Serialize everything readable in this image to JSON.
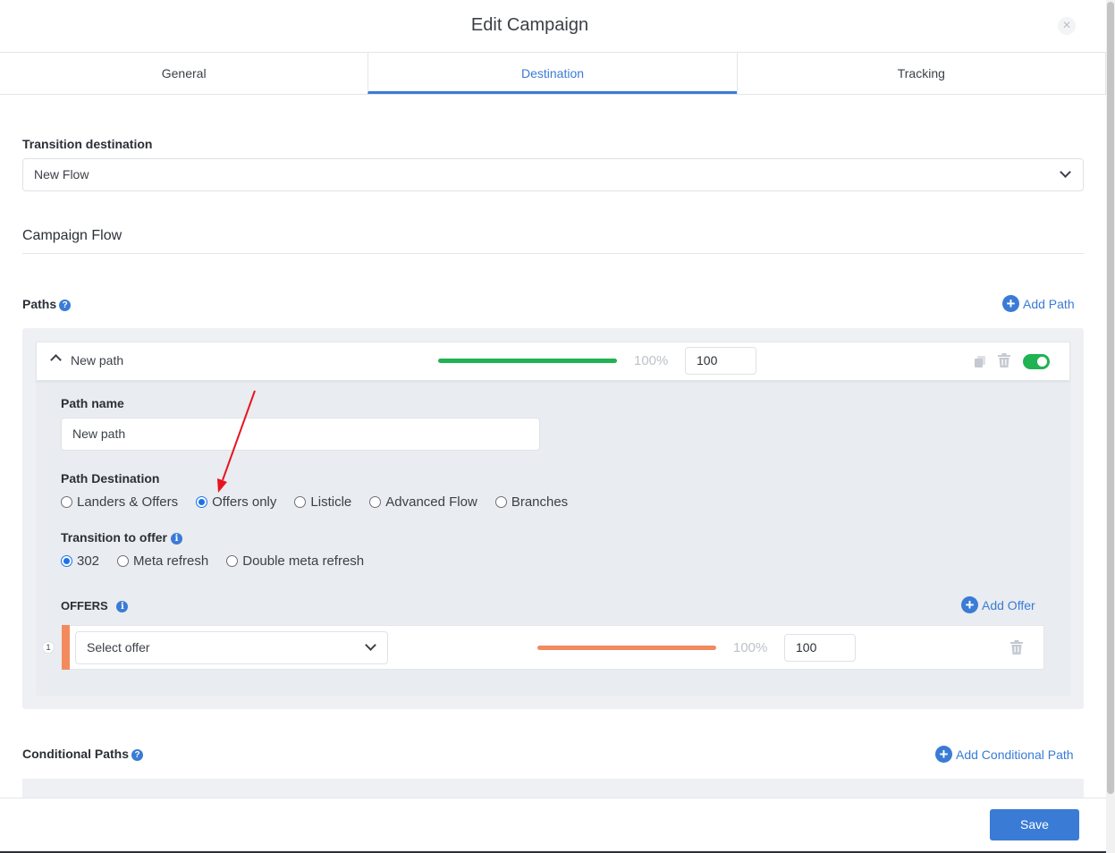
{
  "modal": {
    "title": "Edit Campaign",
    "close_glyph": "×"
  },
  "tabs": [
    {
      "label": "General"
    },
    {
      "label": "Destination"
    },
    {
      "label": "Tracking"
    }
  ],
  "transition_destination": {
    "label": "Transition destination",
    "value": "New Flow"
  },
  "campaign_flow": {
    "title": "Campaign Flow"
  },
  "paths": {
    "label": "Paths",
    "add_label": "Add Path",
    "path": {
      "header_name": "New path",
      "weight_percent": "100%",
      "weight_value": "100",
      "weight_fraction": 1.0,
      "enabled": true,
      "name_label": "Path name",
      "name_value": "New path",
      "destination_label": "Path Destination",
      "destination_options": [
        "Landers & Offers",
        "Offers only",
        "Listicle",
        "Advanced Flow",
        "Branches"
      ],
      "destination_selected": "Offers only",
      "transition_label": "Transition to offer",
      "transition_options": [
        "302",
        "Meta refresh",
        "Double meta refresh"
      ],
      "transition_selected": "302",
      "offers": {
        "label": "OFFERS",
        "add_label": "Add Offer",
        "items": [
          {
            "index": "1",
            "placeholder": "Select offer",
            "weight_percent": "100%",
            "weight_value": "100"
          }
        ]
      }
    }
  },
  "conditional_paths": {
    "label": "Conditional Paths",
    "add_label": "Add Conditional Path"
  },
  "footer": {
    "save_label": "Save"
  },
  "colors": {
    "accent": "#3a7bd5",
    "path_bar": "#20b253",
    "offer_bar": "#f28a5e",
    "annotation_arrow": "#e8141e"
  },
  "icons": [
    "close-icon",
    "chevron-down-icon",
    "chevron-up-icon",
    "help-icon",
    "info-icon",
    "plus-circle-icon",
    "copy-icon",
    "trash-icon"
  ]
}
